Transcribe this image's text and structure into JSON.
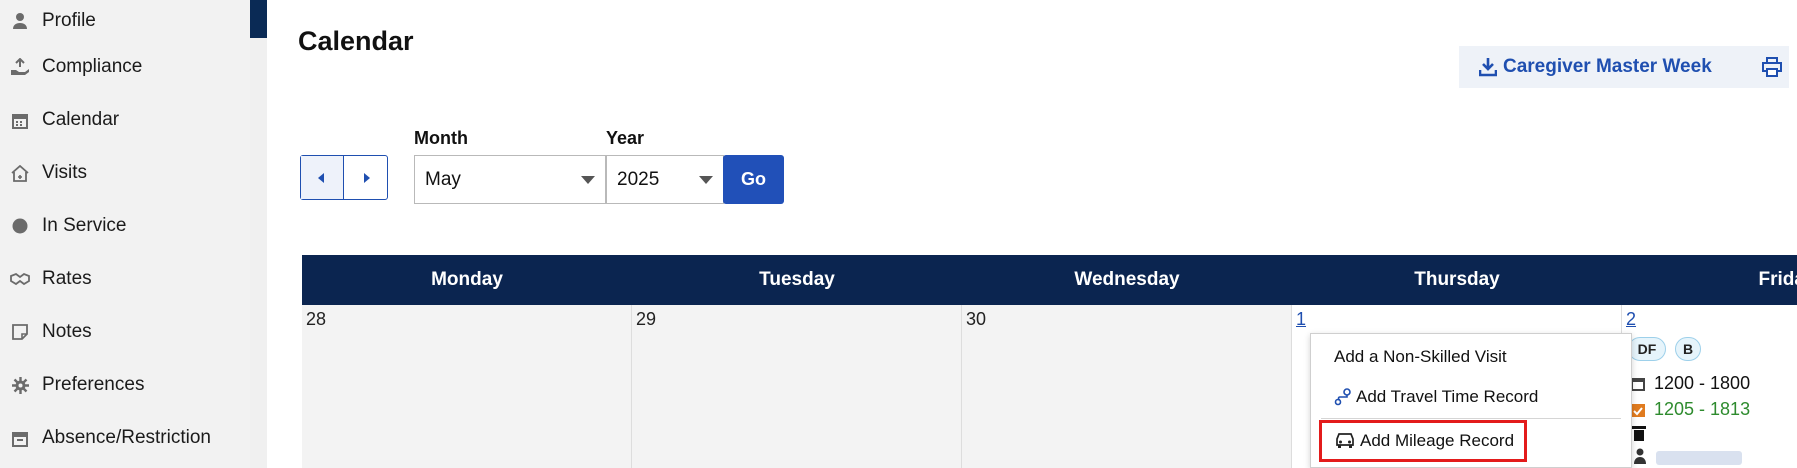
{
  "sidebar": {
    "items": [
      {
        "label": "Profile",
        "icon": "user-icon"
      },
      {
        "label": "Compliance",
        "icon": "hand-upload-icon"
      },
      {
        "label": "Calendar",
        "icon": "calendar-icon"
      },
      {
        "label": "Visits",
        "icon": "home-icon"
      },
      {
        "label": "In Service",
        "icon": "circle-icon"
      },
      {
        "label": "Rates",
        "icon": "handshake-icon"
      },
      {
        "label": "Notes",
        "icon": "note-icon"
      },
      {
        "label": "Preferences",
        "icon": "gear-icon"
      },
      {
        "label": "Absence/Restriction",
        "icon": "calendar-x-icon"
      }
    ]
  },
  "header": {
    "title": "Calendar",
    "master_week_label": "Caregiver Master Week"
  },
  "filters": {
    "month_label": "Month",
    "month_value": "May",
    "year_label": "Year",
    "year_value": "2025",
    "go_label": "Go"
  },
  "calendar": {
    "days": [
      "Monday",
      "Tuesday",
      "Wednesday",
      "Thursday",
      "Friday"
    ],
    "dates": [
      "28",
      "29",
      "30",
      "1",
      "2"
    ],
    "friday": {
      "badges": [
        "DF",
        "B"
      ],
      "scheduled": "1200 - 1800",
      "actual": "1205 - 1813"
    }
  },
  "context_menu": {
    "items": [
      "Add a Non-Skilled Visit",
      "Add Travel Time Record",
      "Add Mileage Record"
    ]
  },
  "colors": {
    "navy": "#0b2550",
    "accent_blue": "#2150b8",
    "highlight_red": "#e31b1b",
    "actual_green": "#2e8b2e",
    "actual_icon_orange": "#e07b1f"
  }
}
